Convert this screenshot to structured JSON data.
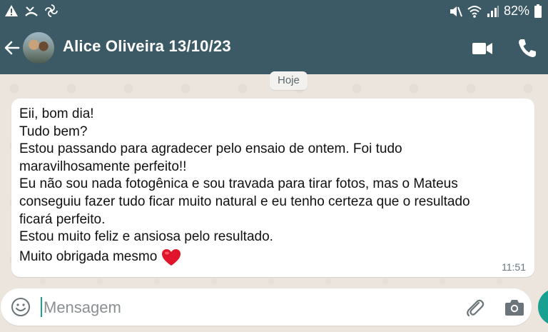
{
  "status_bar": {
    "battery_text": "82%",
    "icons": [
      "warning-icon",
      "missed-call-icon",
      "pinwheel-icon",
      "mute-icon",
      "wifi-icon",
      "signal-icon",
      "battery-icon"
    ]
  },
  "header": {
    "contact_name": "Alice Oliveira 13/10/23",
    "icons": [
      "back-arrow-icon",
      "video-call-icon",
      "phone-call-icon"
    ]
  },
  "chat": {
    "date_chip": "Hoje",
    "message": {
      "lines": [
        "Eii, bom dia!",
        "Tudo bem?",
        "Estou passando para agradecer pelo ensaio de ontem. Foi tudo",
        "maravilhosamente perfeito!!",
        "Eu não sou nada fotogênica e sou travada para tirar fotos, mas o Mateus",
        "conseguiu fazer tudo ficar muito natural e eu tenho certeza que o resultado",
        "ficará perfeito.",
        "Estou muito feliz e ansiosa pelo resultado."
      ],
      "last_line": "Muito obrigada mesmo",
      "time": "11:51",
      "emoji": "heart-icon"
    }
  },
  "input": {
    "placeholder": "Mensagem",
    "value": "",
    "icons": [
      "emoji-icon",
      "paperclip-icon",
      "camera-icon",
      "mic-icon"
    ]
  },
  "colors": {
    "header_bg": "#3c5a65",
    "chat_bg": "#ece5dd",
    "bubble_bg": "#ffffff",
    "accent": "#1aa091",
    "heart": "#e0142a"
  }
}
